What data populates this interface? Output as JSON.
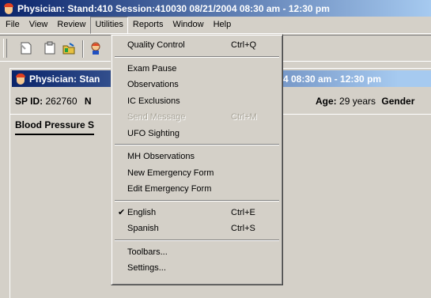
{
  "window": {
    "title": "Physician: Stand:410 Session:410030 08/21/2004 08:30 am - 12:30 pm"
  },
  "menubar": {
    "items": [
      {
        "label": "File"
      },
      {
        "label": "View"
      },
      {
        "label": "Review"
      },
      {
        "label": "Utilities"
      },
      {
        "label": "Reports"
      },
      {
        "label": "Window"
      },
      {
        "label": "Help"
      }
    ]
  },
  "toolbar": {
    "icons": [
      "new-document-icon",
      "clipboard-icon",
      "open-folder-icon",
      "patient-icon"
    ]
  },
  "child_window": {
    "title_left": "Physician: Stan",
    "title_right": "4 08:30 am - 12:30 pm",
    "sp_id_label": "SP ID:",
    "sp_id_value": "262760",
    "truncated_label": "N",
    "age_label": "Age:",
    "age_value": "29 years",
    "gender_label": "Gender",
    "tab_label": "Blood Pressure S"
  },
  "utilities_menu": {
    "quality_control": {
      "label": "Quality Control",
      "shortcut": "Ctrl+Q"
    },
    "exam_pause": {
      "label": "Exam Pause"
    },
    "observations": {
      "label": "Observations"
    },
    "ic_exclusions": {
      "label": "IC Exclusions"
    },
    "send_message": {
      "label": "Send Message",
      "shortcut": "Ctrl+M"
    },
    "ufo_sighting": {
      "label": "UFO Sighting"
    },
    "mh_observations": {
      "label": "MH Observations"
    },
    "new_emergency_form": {
      "label": "New Emergency Form"
    },
    "edit_emergency_form": {
      "label": "Edit Emergency Form"
    },
    "english": {
      "label": "English",
      "shortcut": "Ctrl+E",
      "checked": true
    },
    "spanish": {
      "label": "Spanish",
      "shortcut": "Ctrl+S"
    },
    "toolbars": {
      "label": "Toolbars..."
    },
    "settings": {
      "label": "Settings..."
    }
  },
  "colors": {
    "titlebar_start": "#0a246a",
    "titlebar_end": "#a6caf0",
    "face": "#d4d0c8"
  }
}
